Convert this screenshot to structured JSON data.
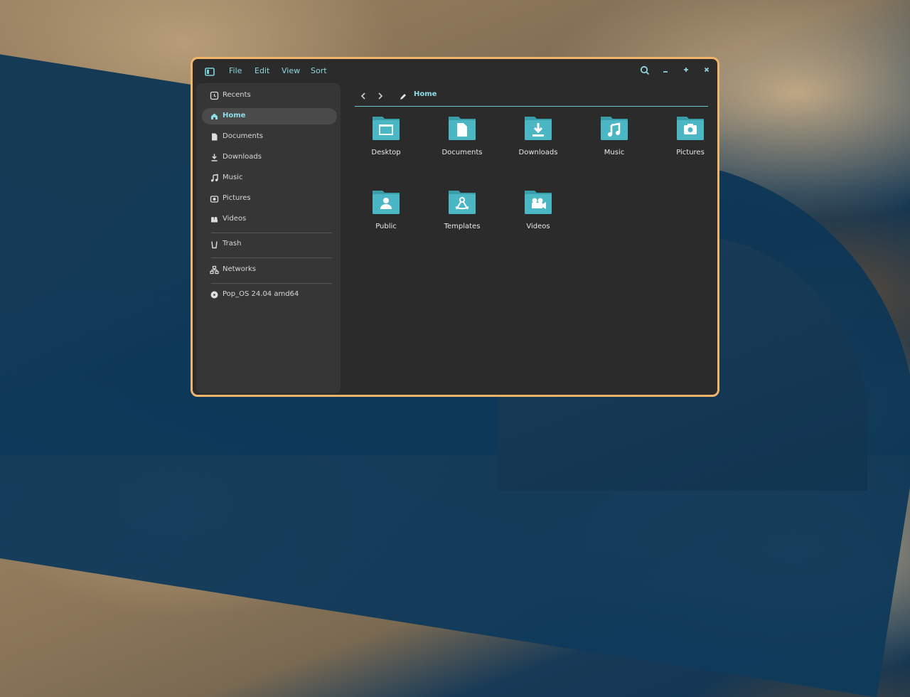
{
  "menu": {
    "file": "File",
    "edit": "Edit",
    "view": "View",
    "sort": "Sort"
  },
  "sidebar": {
    "items": [
      {
        "label": "Recents"
      },
      {
        "label": "Home"
      },
      {
        "label": "Documents"
      },
      {
        "label": "Downloads"
      },
      {
        "label": "Music"
      },
      {
        "label": "Pictures"
      },
      {
        "label": "Videos"
      },
      {
        "label": "Trash"
      },
      {
        "label": "Networks"
      },
      {
        "label": "Pop_OS 24.04 amd64"
      }
    ]
  },
  "path": {
    "current": "Home"
  },
  "folders": [
    {
      "name": "Desktop"
    },
    {
      "name": "Documents"
    },
    {
      "name": "Downloads"
    },
    {
      "name": "Music"
    },
    {
      "name": "Pictures"
    },
    {
      "name": "Public"
    },
    {
      "name": "Templates"
    },
    {
      "name": "Videos"
    }
  ],
  "colors": {
    "accent": "#8fdde6",
    "window_border": "#f0b56a",
    "folder": "#4bb6c4"
  },
  "icons": {
    "sidebar_toggle": "sidebar-toggle-icon",
    "search": "search-icon",
    "minimize": "minimize-icon",
    "maximize": "maximize-icon",
    "close": "close-icon"
  }
}
